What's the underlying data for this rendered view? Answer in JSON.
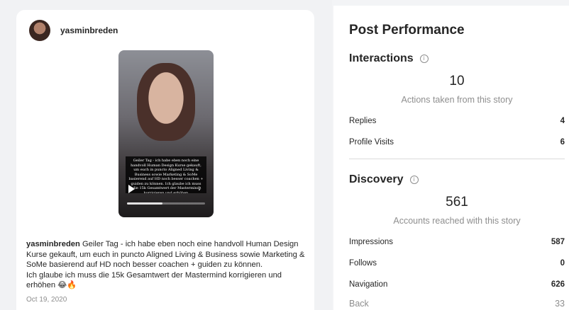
{
  "post": {
    "username": "yasminbreden",
    "story_text": "Geiler Tag - ich habe eben noch eine handvoll Human Design Kurse gekauft, um euch in puncto Aligned Living & Business sowie Marketing & SoMe basierend auf HD noch besser coachen + guiden zu können. Ich glaube ich muss die 15k Gesamtwert der Mastermind korrigieren und erhöhen",
    "progress": 0.45,
    "caption_user": "yasminbreden",
    "caption_line1": " Geiler Tag - ich habe eben noch eine handvoll Human Design Kurse gekauft, um euch in puncto Aligned Living & Business sowie Marketing & SoMe basierend auf HD noch besser coachen + guiden zu können.",
    "caption_line2": "Ich glaube ich muss die 15k Gesamtwert der Mastermind korrigieren und erhöhen 😂🔥",
    "date": "Oct 19, 2020"
  },
  "performance": {
    "title": "Post Performance",
    "interactions": {
      "title": "Interactions",
      "total": "10",
      "subtitle": "Actions taken from this story",
      "rows": [
        {
          "label": "Replies",
          "value": "4"
        },
        {
          "label": "Profile Visits",
          "value": "6"
        }
      ]
    },
    "discovery": {
      "title": "Discovery",
      "total": "561",
      "subtitle": "Accounts reached with this story",
      "rows": [
        {
          "label": "Impressions",
          "value": "587"
        },
        {
          "label": "Follows",
          "value": "0"
        },
        {
          "label": "Navigation",
          "value": "626"
        },
        {
          "label": "Back",
          "value": "33"
        }
      ]
    }
  },
  "icons": {
    "info": "info-icon",
    "play": "play-icon",
    "volume": "volume-icon"
  }
}
